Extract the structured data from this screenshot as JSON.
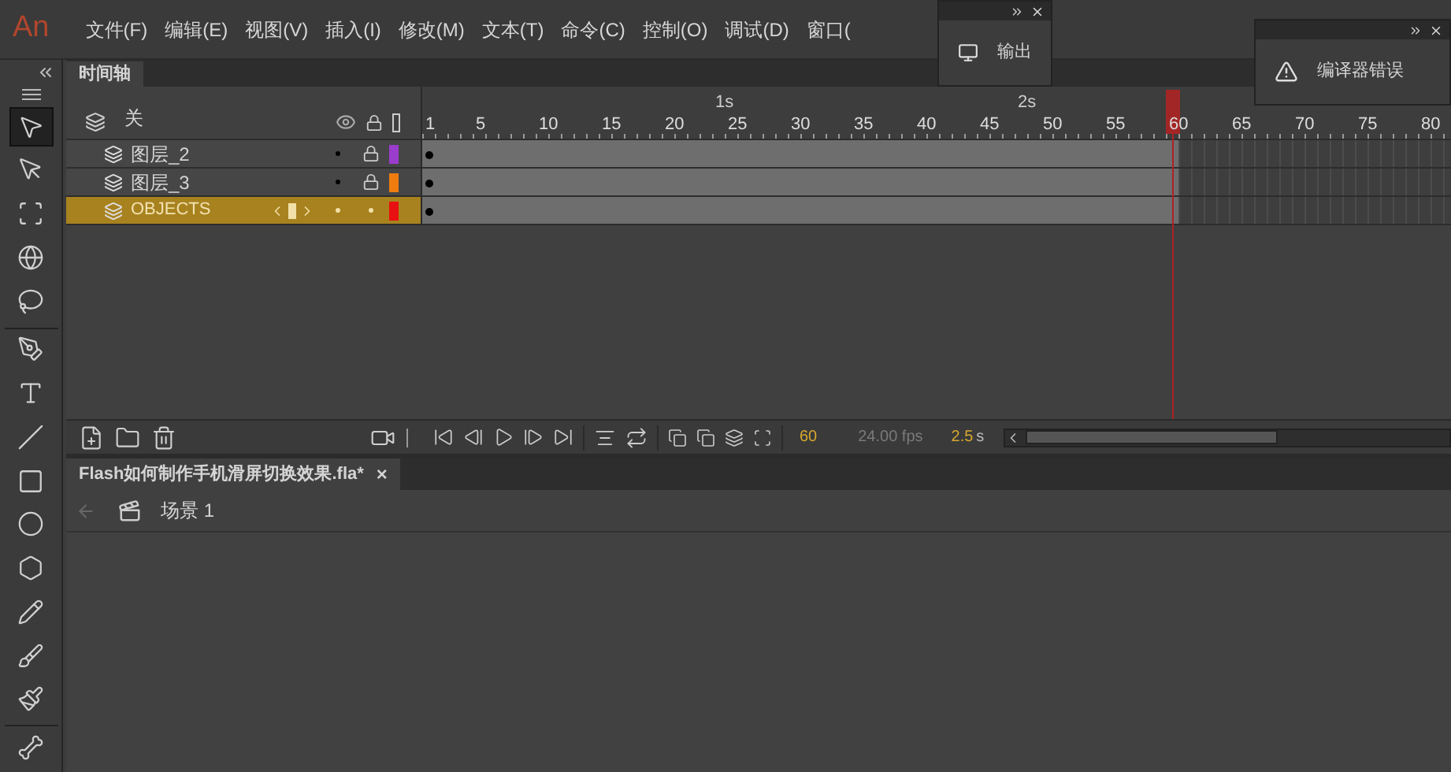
{
  "app_logo": "An",
  "menu": [
    "文件(F)",
    "编辑(E)",
    "视图(V)",
    "插入(I)",
    "修改(M)",
    "文本(T)",
    "命令(C)",
    "控制(O)",
    "调试(D)",
    "窗口("
  ],
  "floating_panels": [
    {
      "kind": "output",
      "title": "输出"
    },
    {
      "kind": "errors",
      "title": "编译器错误"
    }
  ],
  "tools": [
    {
      "kind": "selection",
      "selected": true
    },
    {
      "kind": "subselection",
      "selected": false
    },
    {
      "kind": "transform",
      "selected": false
    },
    {
      "kind": "rotate3d",
      "selected": false
    },
    {
      "kind": "lasso",
      "selected": false
    },
    {
      "kind": "pen",
      "selected": false
    },
    {
      "kind": "text",
      "selected": false
    },
    {
      "kind": "line",
      "selected": false
    },
    {
      "kind": "rectangle",
      "selected": false
    },
    {
      "kind": "oval",
      "selected": false
    },
    {
      "kind": "polygon",
      "selected": false
    },
    {
      "kind": "pencil",
      "selected": false
    },
    {
      "kind": "brush",
      "selected": false
    },
    {
      "kind": "paintbrush",
      "selected": false
    },
    {
      "kind": "bone",
      "selected": false
    }
  ],
  "timeline": {
    "tab": "时间轴",
    "header_label": "关",
    "seconds": [
      "1s",
      "2s"
    ],
    "ticks": [
      "1",
      "5",
      "10",
      "15",
      "20",
      "25",
      "30",
      "35",
      "40",
      "45",
      "50",
      "55",
      "60",
      "65",
      "70",
      "75",
      "80"
    ],
    "layers": [
      {
        "name": "图层_2",
        "selected": false,
        "locked": true,
        "color": "#9a3ccc",
        "span": {
          "level": 0.735
        }
      },
      {
        "name": "图层_3",
        "selected": false,
        "locked": true,
        "color": "#f07c10",
        "span": {
          "level": 0.735
        }
      },
      {
        "name": "OBJECTS",
        "selected": true,
        "locked": false,
        "color": "#e81010",
        "span": {
          "level": 0.735
        }
      }
    ],
    "current_frame": "60",
    "frame_rate": "24.00 fps",
    "elapsed": {
      "value": "2.5",
      "unit": "s"
    }
  },
  "document_tab": {
    "title": "Flash如何制作手机滑屏切换效果.fla*",
    "close": "×"
  },
  "scene": "场景 1"
}
